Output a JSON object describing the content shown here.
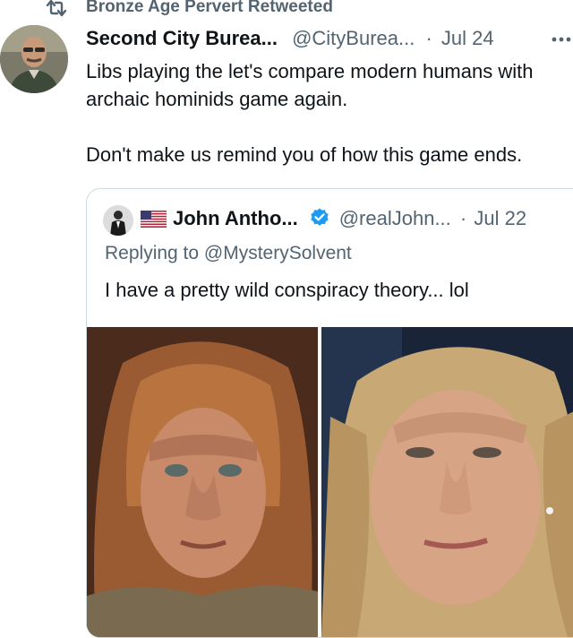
{
  "retweet": {
    "icon": "retweet-icon",
    "label": "Bronze Age Pervert Retweeted"
  },
  "tweet": {
    "author_name": "Second City Burea...",
    "author_handle": "@CityBurea...",
    "separator": "·",
    "date": "Jul 24",
    "more_icon": "more-horizontal-icon",
    "text": "Libs playing the let's compare modern humans with archaic hominids game again.\n\nDon't make us remind you of how this game ends."
  },
  "quote": {
    "flag_icon": "us-flag-icon",
    "author_name": "John Antho...",
    "verified_icon": "verified-badge-icon",
    "author_handle": "@realJohn...",
    "separator": "·",
    "date": "Jul 22",
    "replying_to": "Replying to @MysterySolvent",
    "text": "I have a pretty wild conspiracy theory... lol",
    "media": [
      "neanderthal-reconstruction-photo",
      "woman-portrait-photo"
    ]
  },
  "colors": {
    "secondary_text": "#536471",
    "primary_text": "#0f1419",
    "verified_blue": "#1d9bf0",
    "border": "#cfd9de"
  }
}
